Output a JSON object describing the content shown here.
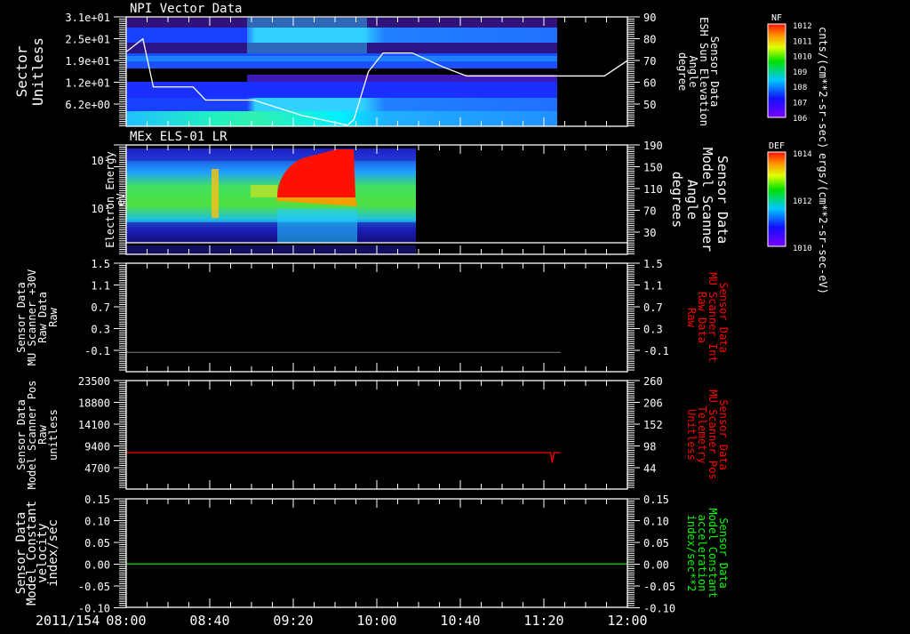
{
  "colors": {
    "background": "#000000",
    "axis": "#ffffff",
    "elevation_line": "#ffffff",
    "mu_int_line": "#808080",
    "mu_pos_line": "#ff0000",
    "model_line": "#00ff00",
    "red_label": "#ff0000",
    "green_label": "#00ff00"
  },
  "xaxis": {
    "date": "2011/154",
    "ticks": [
      "08:00",
      "08:40",
      "09:20",
      "10:00",
      "10:40",
      "11:20",
      "12:00"
    ]
  },
  "chart_data": [
    {
      "type": "heatmap",
      "title": "NPI Vector Data",
      "ylabel": [
        "Sector",
        "Unitless"
      ],
      "yticks": [
        "3.1e+01",
        "2.5e+01",
        "1.9e+01",
        "1.2e+01",
        "6.2e+00"
      ],
      "colorbar": {
        "label": "NF",
        "ticks": [
          "10^12",
          "10^11",
          "10^10",
          "10^9",
          "10^8",
          "10^7",
          "10^6"
        ],
        "units": "cnts/(cm**2-sr-sec)"
      },
      "data_end": "11:26",
      "overlay": {
        "type": "line",
        "ylabel": [
          "Sensor Data",
          "ESH Sun Elevation",
          "Angle",
          "degree"
        ],
        "yticks": [
          "90",
          "80",
          "70",
          "60",
          "50"
        ],
        "ylim": [
          40,
          90
        ],
        "points": [
          [
            "08:00",
            74
          ],
          [
            "08:08",
            80
          ],
          [
            "08:13",
            58
          ],
          [
            "08:32",
            58
          ],
          [
            "08:38",
            52
          ],
          [
            "09:01",
            52
          ],
          [
            "09:24",
            45
          ],
          [
            "09:46",
            40.5
          ],
          [
            "09:49",
            43
          ],
          [
            "09:56",
            65
          ],
          [
            "10:03",
            73.5
          ],
          [
            "10:17",
            73.5
          ],
          [
            "10:32",
            67
          ],
          [
            "10:43",
            63
          ],
          [
            "11:49",
            63
          ],
          [
            "12:00",
            70
          ]
        ]
      }
    },
    {
      "type": "heatmap",
      "title": "MEx ELS-01 LR",
      "ylabel": [
        "Electron Energy",
        "eV"
      ],
      "yticks": [
        "10^2",
        "10^1"
      ],
      "yscale": "log",
      "colorbar": {
        "label": "DEF",
        "ticks": [
          "10^14",
          "10^12",
          "10^10"
        ],
        "units": "ergs/(cm**2-sr-sec-eV)"
      },
      "data_end": "10:19",
      "overlay": {
        "type": "line",
        "ylabel": [
          "Sensor Data",
          "Model Scanner",
          "Angle",
          "degrees"
        ],
        "yticks": [
          "190",
          "150",
          "110",
          "70",
          "30"
        ],
        "ylim": [
          10,
          190
        ]
      }
    },
    {
      "type": "line",
      "ylabel": [
        "Sensor Data",
        "MU Scanner +30V",
        "Raw Data",
        "Raw"
      ],
      "yticks": [
        "1.5",
        "1.1",
        "0.7",
        "0.3",
        "-0.1"
      ],
      "ylim": [
        -0.3,
        1.5
      ],
      "value": 0.02,
      "x_end": "11:28",
      "right": {
        "ylabel": [
          "Sensor Data",
          "MU Scanner Int",
          "Raw Data",
          "Raw"
        ],
        "yticks": [
          "1.5",
          "1.1",
          "0.7",
          "0.3",
          "-0.1"
        ]
      }
    },
    {
      "type": "line",
      "ylabel": [
        "Sensor Data",
        "Model Scanner Pos",
        "Raw",
        "unitless"
      ],
      "yticks": [
        "23500",
        "18800",
        "14100",
        "9400",
        "4700"
      ],
      "ylim": [
        0,
        23500
      ],
      "value": 7900,
      "dip": {
        "time": "11:24",
        "value": 5700
      },
      "x_end": "11:28",
      "right": {
        "ylabel": [
          "Sensor Data",
          "MU Scanner Pos",
          "Telemetry",
          "Unitless"
        ],
        "yticks": [
          "260",
          "206",
          "152",
          "98",
          "44"
        ]
      }
    },
    {
      "type": "line",
      "ylabel": [
        "Sensor Data",
        "Model Constant",
        "velocity",
        "index/sec"
      ],
      "yticks": [
        "0.15",
        "0.10",
        "0.05",
        "0.00",
        "-0.05",
        "-0.10"
      ],
      "ylim": [
        -0.1,
        0.15
      ],
      "value": 0.0,
      "right": {
        "ylabel": [
          "Sensor Data",
          "Model Constant",
          "acceleration",
          "index/sec**2"
        ],
        "yticks": [
          "0.15",
          "0.10",
          "0.05",
          "0.00",
          "-0.05",
          "-0.10"
        ]
      }
    }
  ]
}
